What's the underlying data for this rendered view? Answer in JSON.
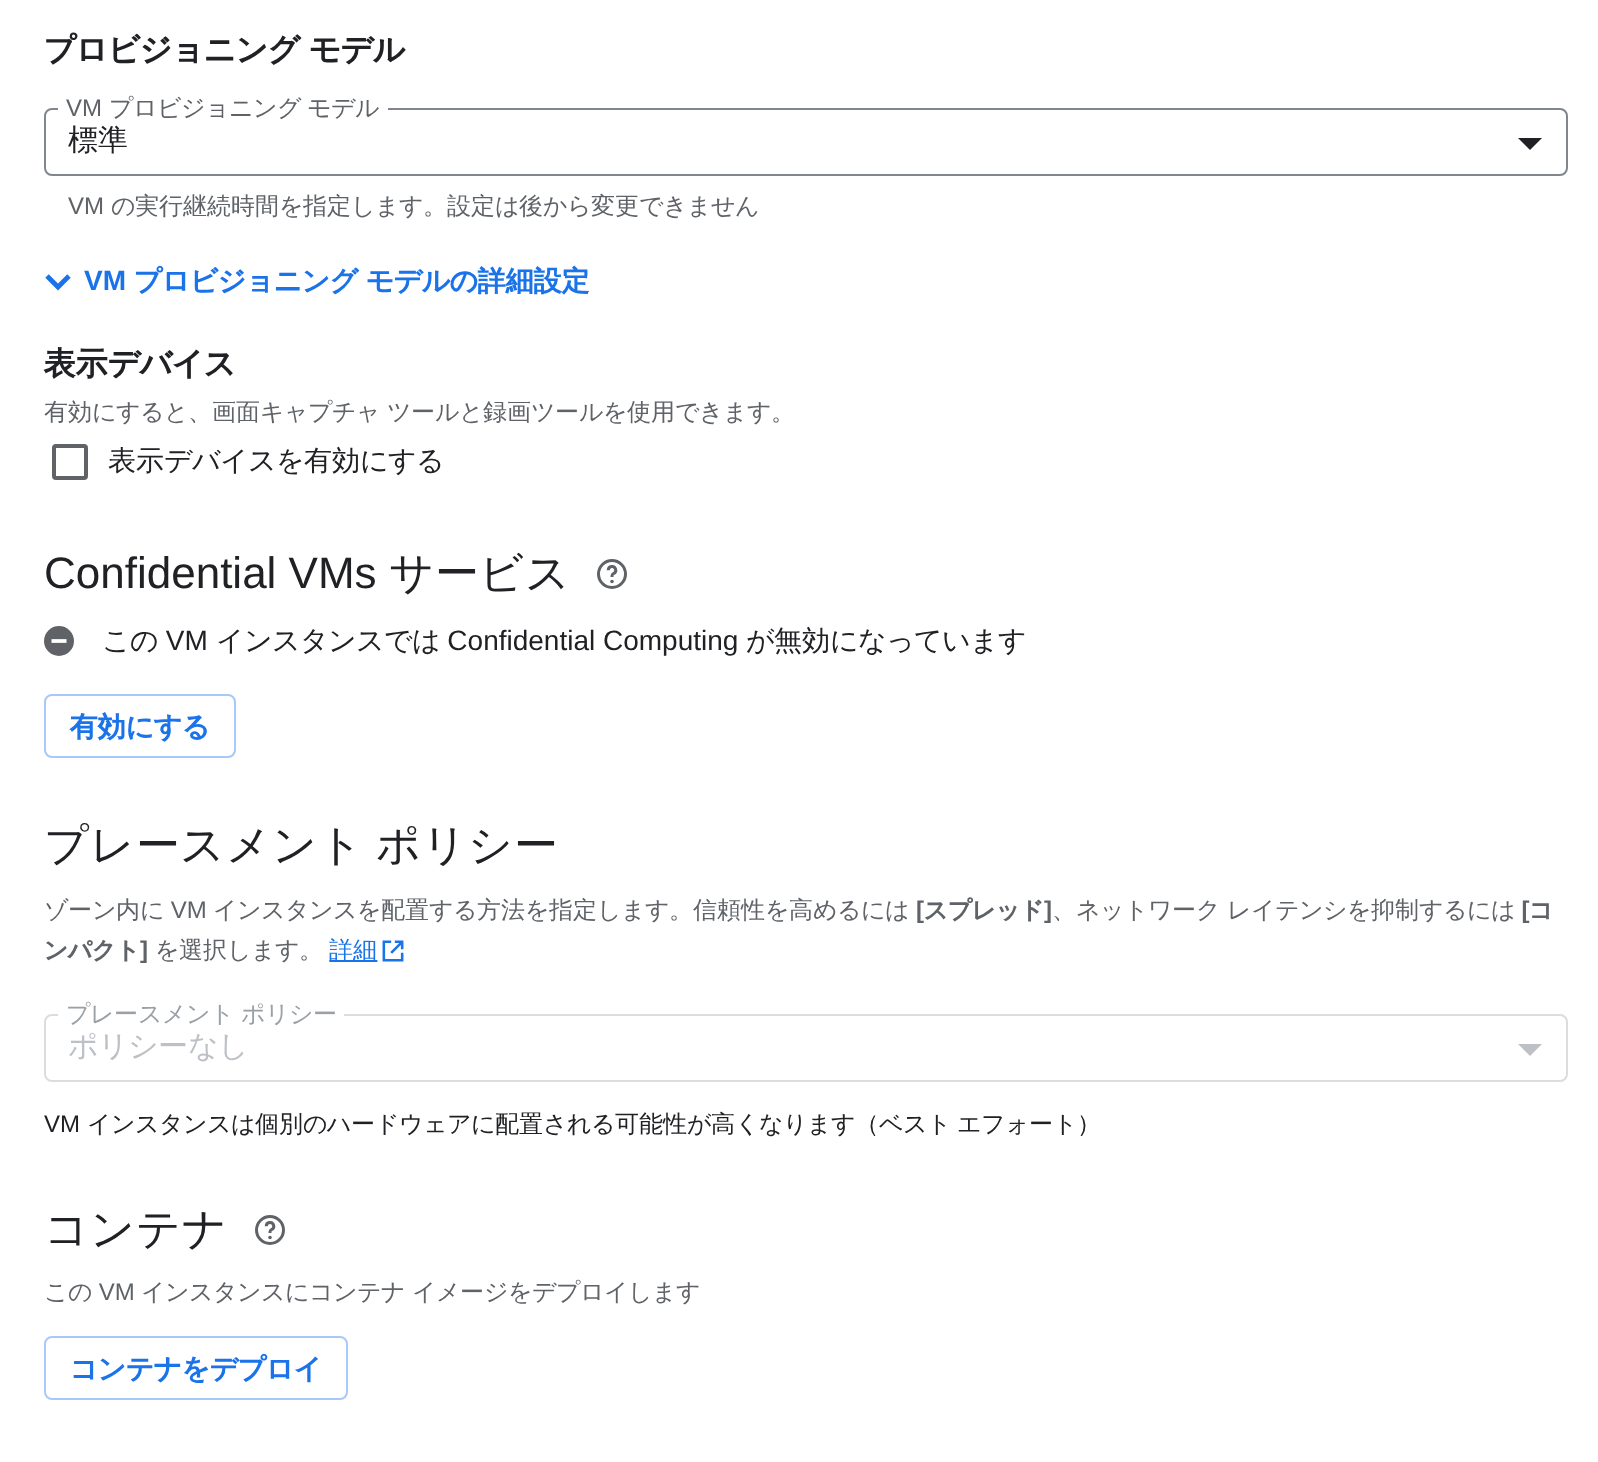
{
  "provisioning": {
    "heading": "プロビジョニング モデル",
    "select": {
      "label": "VM プロビジョニング モデル",
      "value": "標準",
      "disabled": false
    },
    "hint": "VM の実行継続時間を指定します。設定は後から変更できません",
    "advanced": {
      "label": "VM プロビジョニング モデルの詳細設定",
      "expanded": false
    }
  },
  "display_device": {
    "heading": "表示デバイス",
    "description": "有効にすると、画面キャプチャ ツールと録画ツールを使用できます。",
    "checkbox": {
      "label": "表示デバイスを有効にする",
      "checked": false
    }
  },
  "confidential": {
    "heading": "Confidential VMs サービス",
    "status": "この VM インスタンスでは Confidential Computing が無効になっています",
    "button": "有効にする"
  },
  "placement": {
    "heading": "プレースメント ポリシー",
    "description": "ゾーン内に VM インスタンスを配置する方法を指定します。信頼性を高めるには **[スプレッド]**、ネットワーク レイテンシを抑制するには **[コンパクト]** を選択します。",
    "link": "詳細",
    "select": {
      "label": "プレースメント ポリシー",
      "value": "ポリシーなし",
      "disabled": true
    },
    "hint": "VM インスタンスは個別のハードウェアに配置される可能性が高くなります（ベスト エフォート）"
  },
  "container": {
    "heading": "コンテナ",
    "description": "この VM インスタンスにコンテナ イメージをデプロイします",
    "button": "コンテナをデプロイ"
  }
}
